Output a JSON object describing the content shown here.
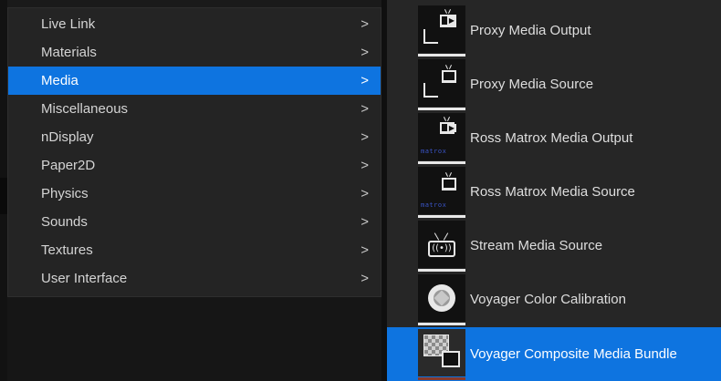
{
  "left_menu": {
    "items": [
      {
        "label": "Live Link",
        "arrow": ">"
      },
      {
        "label": "Materials",
        "arrow": ">"
      },
      {
        "label": "Media",
        "arrow": ">"
      },
      {
        "label": "Miscellaneous",
        "arrow": ">"
      },
      {
        "label": "nDisplay",
        "arrow": ">"
      },
      {
        "label": "Paper2D",
        "arrow": ">"
      },
      {
        "label": "Physics",
        "arrow": ">"
      },
      {
        "label": "Sounds",
        "arrow": ">"
      },
      {
        "label": "Textures",
        "arrow": ">"
      },
      {
        "label": "User Interface",
        "arrow": ">"
      }
    ],
    "selected": "Media"
  },
  "submenu": {
    "items": [
      {
        "label": "Proxy Media Output",
        "icon": "proxy-media-output-icon"
      },
      {
        "label": "Proxy Media Source",
        "icon": "proxy-media-source-icon"
      },
      {
        "label": "Ross Matrox Media Output",
        "icon": "ross-matrox-media-output-icon",
        "brand": "matrox"
      },
      {
        "label": "Ross Matrox Media Source",
        "icon": "ross-matrox-media-source-icon",
        "brand": "matrox"
      },
      {
        "label": "Stream Media Source",
        "icon": "stream-media-source-icon"
      },
      {
        "label": "Voyager Color Calibration",
        "icon": "voyager-color-calibration-icon"
      },
      {
        "label": "Voyager Composite Media Bundle",
        "icon": "voyager-composite-media-bundle-icon"
      }
    ],
    "selected": "Voyager Composite Media Bundle"
  },
  "colors": {
    "selection": "#0e74e0",
    "menu_bg": "#242424",
    "text": "#d4d4d4"
  }
}
